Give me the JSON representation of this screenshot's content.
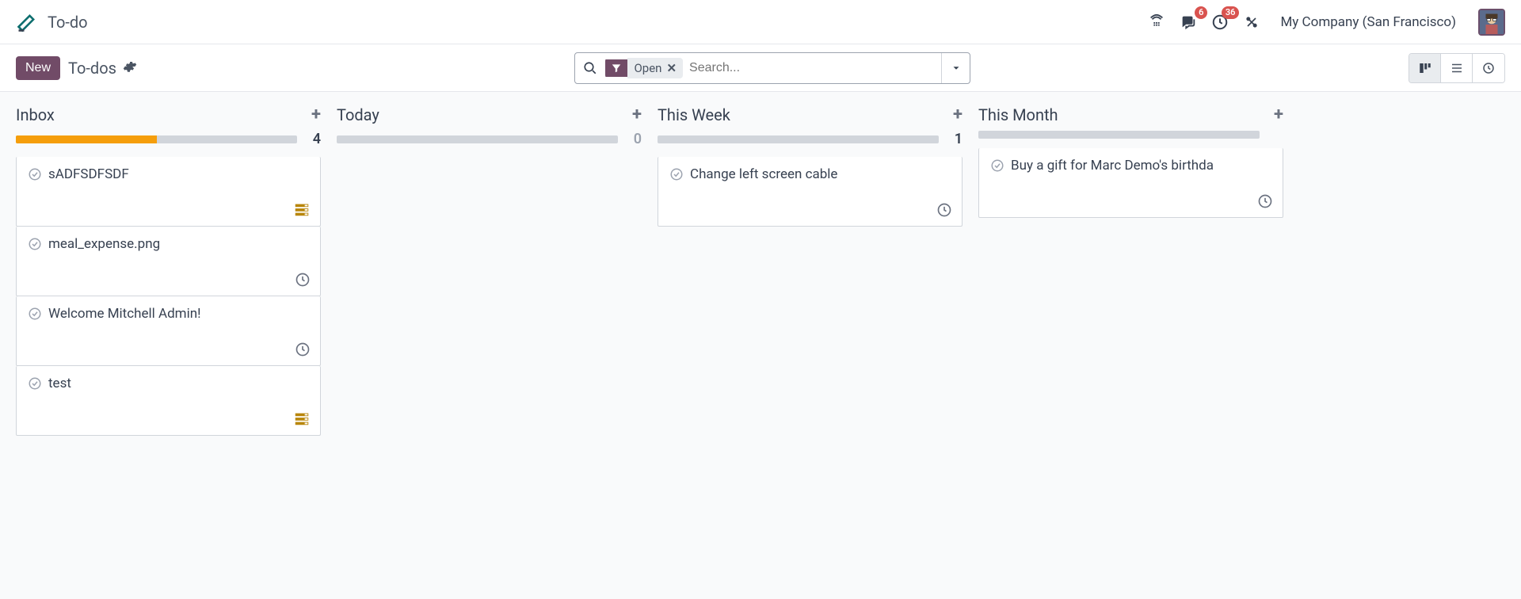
{
  "header": {
    "app_title": "To-do",
    "company": "My Company (San Francisco)",
    "badges": {
      "messages": "6",
      "activities": "36"
    }
  },
  "controlbar": {
    "new_label": "New",
    "breadcrumb": "To-dos",
    "filter_label": "Open",
    "search_placeholder": "Search..."
  },
  "kanban": {
    "columns": [
      {
        "title": "Inbox",
        "count": "4",
        "progress_pct": 50,
        "cards": [
          {
            "title": "sADFSDFSDF",
            "icon": "stack"
          },
          {
            "title": "meal_expense.png",
            "icon": "clock"
          },
          {
            "title": "Welcome Mitchell Admin!",
            "icon": "clock"
          },
          {
            "title": "test",
            "icon": "stack"
          }
        ]
      },
      {
        "title": "Today",
        "count": "0",
        "progress_pct": 0,
        "cards": []
      },
      {
        "title": "This Week",
        "count": "1",
        "progress_pct": 0,
        "cards": [
          {
            "title": "Change left screen cable",
            "icon": "clock"
          }
        ]
      },
      {
        "title": "This Month",
        "count": "",
        "progress_pct": 0,
        "cards": [
          {
            "title": "Buy a gift for Marc Demo's birthda",
            "icon": "clock"
          }
        ]
      }
    ]
  }
}
